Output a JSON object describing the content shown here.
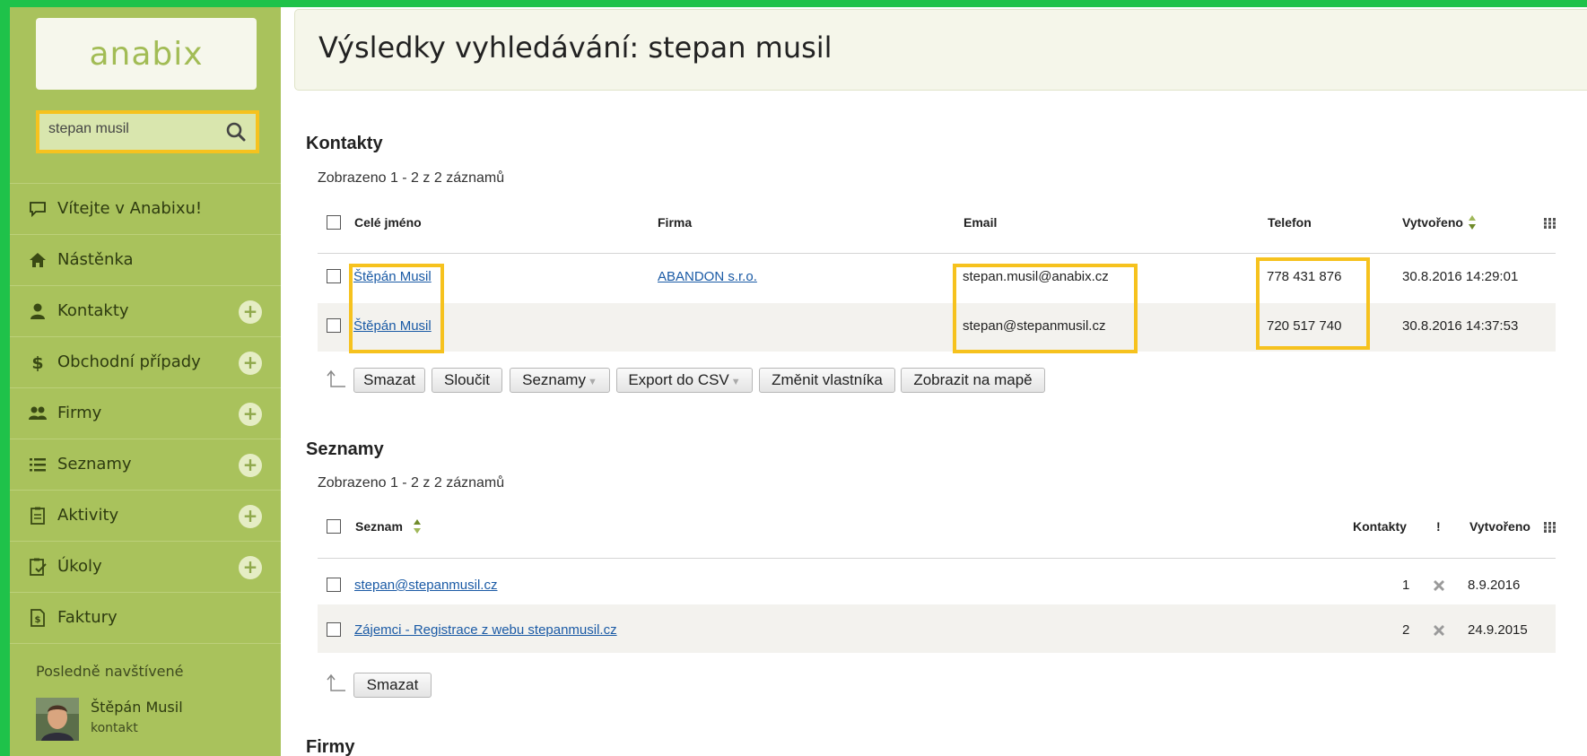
{
  "brand": {
    "logo": "anabix"
  },
  "search": {
    "value": "stepan musil"
  },
  "sidebar": {
    "items": [
      {
        "label": "Vítejte v Anabixu!",
        "icon": "chat-icon",
        "has_add": false
      },
      {
        "label": "Nástěnka",
        "icon": "home-icon",
        "has_add": false
      },
      {
        "label": "Kontakty",
        "icon": "contact-icon",
        "has_add": true
      },
      {
        "label": "Obchodní případy",
        "icon": "dollar-icon",
        "has_add": true
      },
      {
        "label": "Firmy",
        "icon": "companies-icon",
        "has_add": true
      },
      {
        "label": "Seznamy",
        "icon": "list-icon",
        "has_add": true
      },
      {
        "label": "Aktivity",
        "icon": "clipboard-icon",
        "has_add": true
      },
      {
        "label": "Úkoly",
        "icon": "tasks-icon",
        "has_add": true
      },
      {
        "label": "Faktury",
        "icon": "invoice-icon",
        "has_add": false
      }
    ],
    "add_label": "+",
    "recent": {
      "title": "Posledně navštívené",
      "name": "Štěpán Musil",
      "type": "kontakt"
    }
  },
  "header": {
    "title": "Výsledky vyhledávání: stepan musil"
  },
  "contacts": {
    "title": "Kontakty",
    "count": "Zobrazeno 1 - 2 z 2 záznamů",
    "columns": {
      "name": "Celé jméno",
      "company": "Firma",
      "email": "Email",
      "phone": "Telefon",
      "created": "Vytvořeno"
    },
    "rows": [
      {
        "name": "Štěpán Musil",
        "company": "ABANDON s.r.o.",
        "email": "stepan.musil@anabix.cz",
        "phone": "778 431 876",
        "created": "30.8.2016 14:29:01"
      },
      {
        "name": "Štěpán Musil",
        "company": "",
        "email": "stepan@stepanmusil.cz",
        "phone": "720 517 740",
        "created": "30.8.2016 14:37:53"
      }
    ],
    "actions": {
      "delete": "Smazat",
      "merge": "Sloučit",
      "lists": "Seznamy",
      "export": "Export do CSV",
      "owner": "Změnit vlastníka",
      "map": "Zobrazit na mapě"
    }
  },
  "lists": {
    "title": "Seznamy",
    "count": "Zobrazeno 1 - 2 z 2 záznamů",
    "columns": {
      "name": "Seznam",
      "contacts": "Kontakty",
      "flag": "!",
      "created": "Vytvořeno"
    },
    "rows": [
      {
        "name": "stepan@stepanmusil.cz",
        "contacts": "1",
        "created": "8.9.2016"
      },
      {
        "name": "Zájemci - Registrace z webu stepanmusil.cz",
        "contacts": "2",
        "created": "24.9.2015"
      }
    ],
    "actions": {
      "delete": "Smazat"
    }
  },
  "companies": {
    "title": "Firmy"
  },
  "colors": {
    "sidebar": "#a9c25c",
    "highlight": "#f6c21e",
    "frame": "#1fc24a",
    "link": "#1a5aa5"
  }
}
